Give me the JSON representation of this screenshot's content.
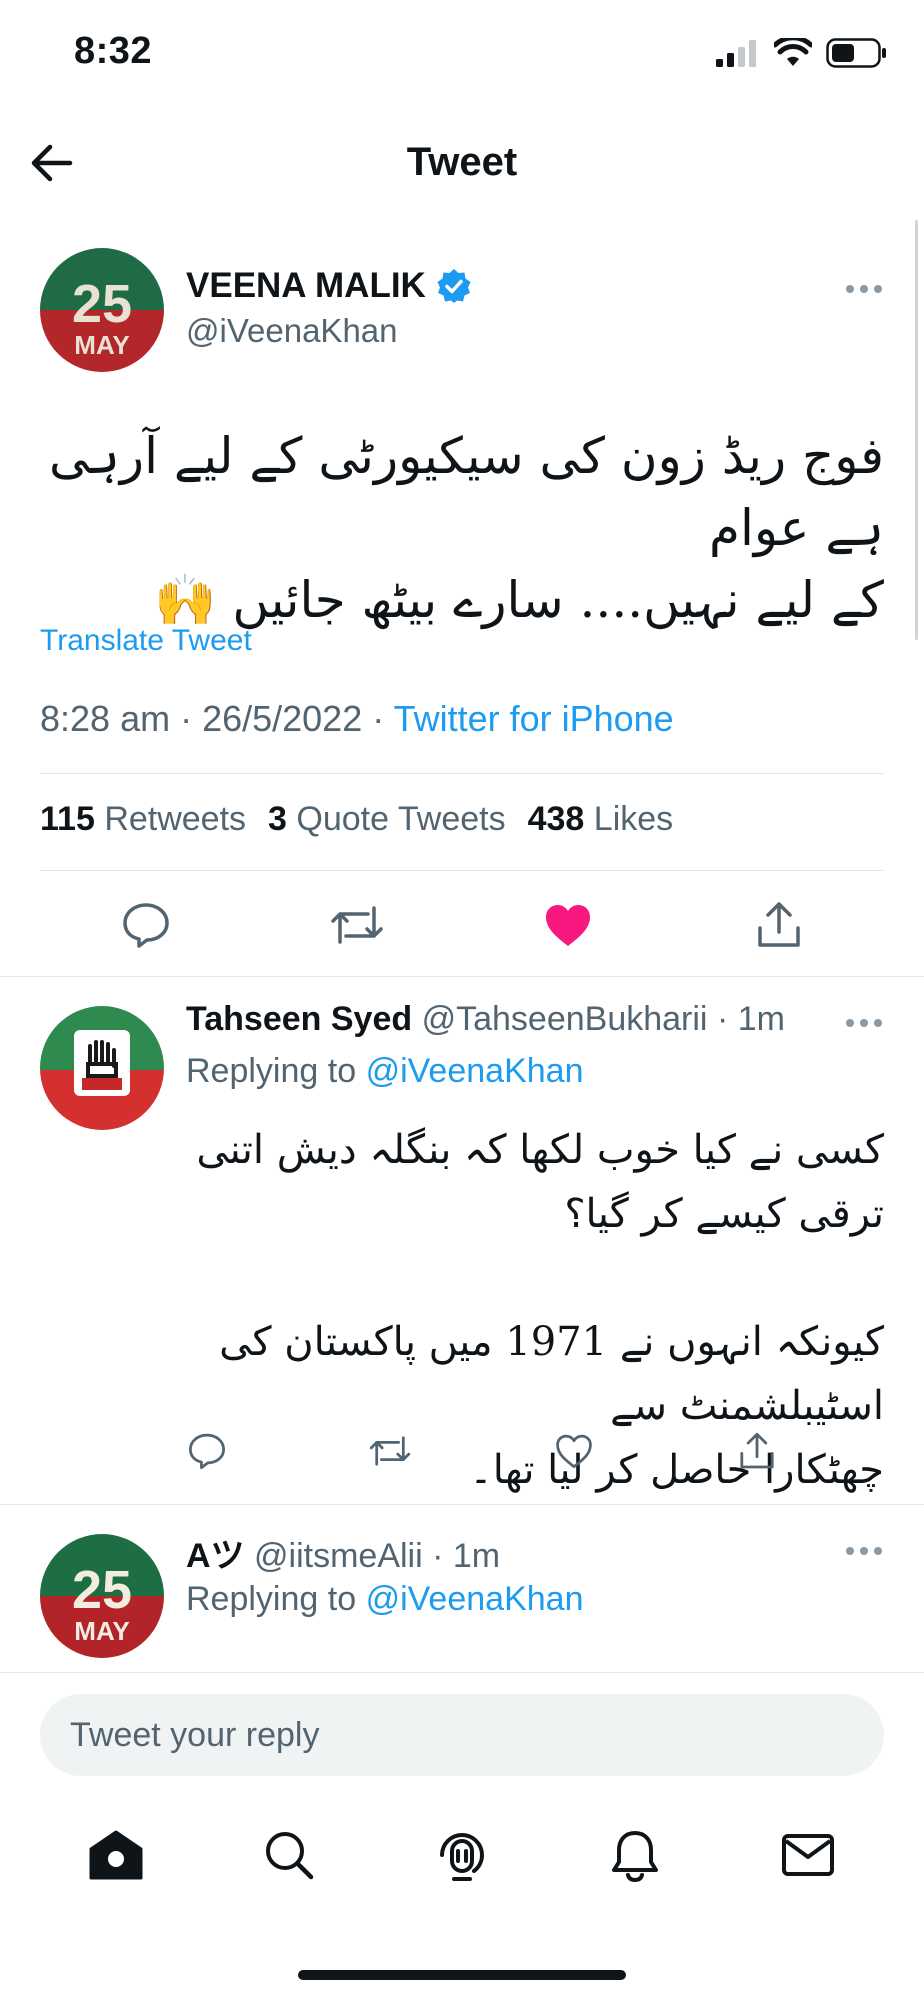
{
  "status_bar": {
    "time": "8:32"
  },
  "header": {
    "title": "Tweet"
  },
  "main_tweet": {
    "avatar_text": "25",
    "avatar_sub": "MAY",
    "display_name": "VEENA MALIK",
    "handle": "@iVeenaKhan",
    "text_line1": "فوج ریڈ زون کی سیکیورٹی کے لیے آرہی ہے عوام",
    "text_line2": "کے لیے نہیں.... سارے بیٹھ جائیں 🙌",
    "translate_label": "Translate Tweet",
    "timestamp": "8:28 am · 26/5/2022 · ",
    "source": "Twitter for iPhone",
    "stats": {
      "retweets_count": "115",
      "retweets_label": "Retweets",
      "quotes_count": "3",
      "quotes_label": "Quote Tweets",
      "likes_count": "438",
      "likes_label": "Likes"
    },
    "liked": true
  },
  "replies": [
    {
      "display_name": "Tahseen Syed",
      "handle": "@TahseenBukharii",
      "time": "· 1m",
      "replying_prefix": "Replying to",
      "replying_to": "@iVeenaKhan",
      "text_line1": "کسی نے کیا خوب لکھا کہ بنگلہ دیش اتنی ترقی کیسے کر گیا؟",
      "text_line2": "کیونکہ انہوں نے 1971 میں پاکستان کی اسٹیبلشمنٹ سے",
      "text_line3": "چھٹکارا حاصل کر لیا تھا۔"
    },
    {
      "display_name": "Aツ",
      "handle": "@iitsmeAlii",
      "time": "· 1m",
      "replying_prefix": "Replying to",
      "replying_to": "@iVeenaKhan",
      "avatar_text": "25",
      "avatar_sub": "MAY"
    }
  ],
  "composer": {
    "placeholder": "Tweet your reply"
  },
  "colors": {
    "accent": "#1d9bf0",
    "like": "#f91880",
    "text": "#0f1419",
    "muted": "#536471"
  }
}
